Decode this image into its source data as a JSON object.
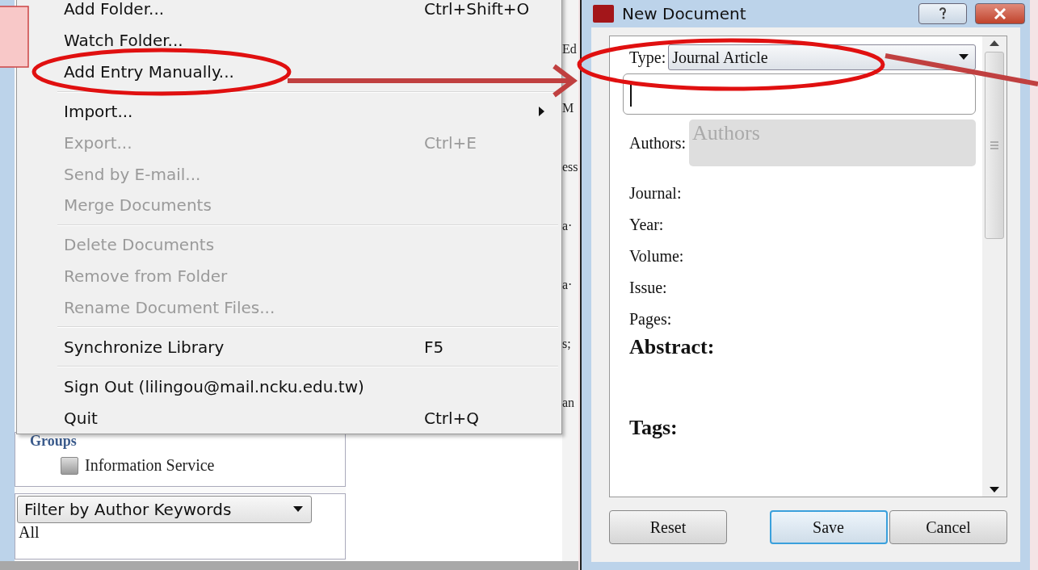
{
  "menu": {
    "items": [
      {
        "kind": "item",
        "label": "Add Folder...",
        "shortcut": "Ctrl+Shift+O",
        "disabled": false,
        "submenu": false
      },
      {
        "kind": "item",
        "label": "Watch Folder...",
        "disabled": false,
        "submenu": false
      },
      {
        "kind": "item",
        "label": "Add Entry Manually...",
        "disabled": false,
        "submenu": false
      },
      {
        "kind": "separator"
      },
      {
        "kind": "item",
        "label": "Import...",
        "disabled": false,
        "submenu": true
      },
      {
        "kind": "item",
        "label": "Export...",
        "shortcut": "Ctrl+E",
        "disabled": true,
        "submenu": false
      },
      {
        "kind": "item",
        "label": "Send by E-mail...",
        "disabled": true,
        "submenu": false
      },
      {
        "kind": "item",
        "label": "Merge Documents",
        "disabled": true,
        "submenu": false
      },
      {
        "kind": "separator"
      },
      {
        "kind": "item",
        "label": "Delete Documents",
        "disabled": true,
        "submenu": false
      },
      {
        "kind": "item",
        "label": "Remove from Folder",
        "disabled": true,
        "submenu": false
      },
      {
        "kind": "item",
        "label": "Rename Document Files...",
        "disabled": true,
        "submenu": false
      },
      {
        "kind": "separator"
      },
      {
        "kind": "item",
        "label": "Synchronize Library",
        "shortcut": "F5",
        "disabled": false,
        "submenu": false
      },
      {
        "kind": "separator"
      },
      {
        "kind": "item",
        "label": "Sign Out (lilingou@mail.ncku.edu.tw)",
        "disabled": false,
        "submenu": false
      },
      {
        "kind": "item",
        "label": "Quit",
        "shortcut": "Ctrl+Q",
        "disabled": false,
        "submenu": false
      }
    ]
  },
  "list_fragments": [
    "Ed",
    "M",
    "ess",
    "a·",
    "a·",
    "s;",
    "an"
  ],
  "sidebar": {
    "section": "Groups",
    "items": [
      {
        "label": "Information Service"
      }
    ],
    "filter": {
      "value": "Filter by Author Keywords"
    },
    "filter_items": [
      "All"
    ]
  },
  "dialog": {
    "title": "New Document",
    "type": {
      "label": "Type:",
      "value": "Journal Article"
    },
    "authors": {
      "label": "Authors:",
      "placeholder": "Authors"
    },
    "rows": [
      {
        "kind": "field",
        "label": "Journal:"
      },
      {
        "kind": "field",
        "label": "Year:"
      },
      {
        "kind": "field",
        "label": "Volume:"
      },
      {
        "kind": "field",
        "label": "Issue:"
      },
      {
        "kind": "field",
        "label": "Pages:"
      },
      {
        "kind": "heading",
        "label": "Abstract:"
      },
      {
        "kind": "heading",
        "label": "Tags:"
      }
    ],
    "buttons": [
      {
        "label": "Reset",
        "default": false
      },
      {
        "label": "Save",
        "default": true
      },
      {
        "label": "Cancel",
        "default": false
      }
    ]
  }
}
